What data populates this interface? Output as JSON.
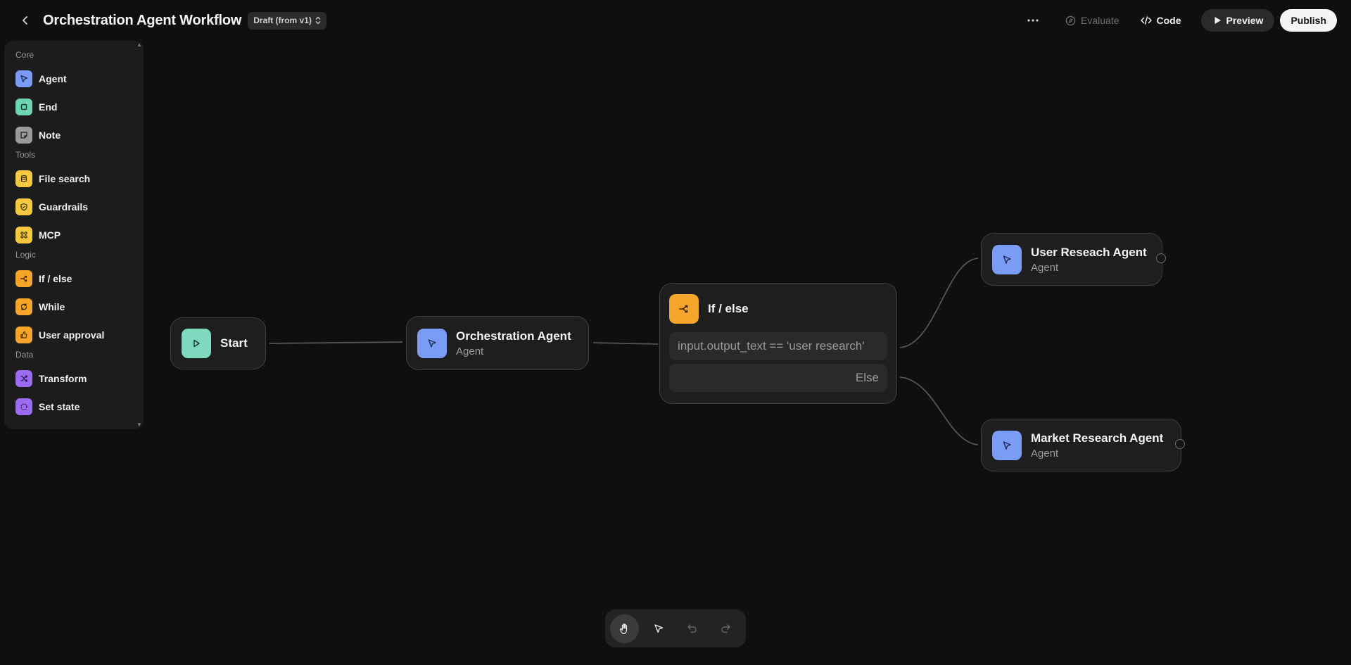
{
  "header": {
    "title": "Orchestration Agent Workflow",
    "draft_badge": "Draft (from v1)",
    "evaluate_label": "Evaluate",
    "code_label": "Code",
    "preview_label": "Preview",
    "publish_label": "Publish"
  },
  "sidebar": {
    "sections": [
      {
        "label": "Core",
        "items": [
          {
            "label": "Agent",
            "icon": "agent-icon",
            "color": "#7b9cf5"
          },
          {
            "label": "End",
            "icon": "end-icon",
            "color": "#6fd4b4"
          },
          {
            "label": "Note",
            "icon": "note-icon",
            "color": "#9a9a9a"
          }
        ]
      },
      {
        "label": "Tools",
        "items": [
          {
            "label": "File search",
            "icon": "database-icon",
            "color": "#f5c842"
          },
          {
            "label": "Guardrails",
            "icon": "shield-icon",
            "color": "#f5c842"
          },
          {
            "label": "MCP",
            "icon": "mcp-icon",
            "color": "#f5c842"
          }
        ]
      },
      {
        "label": "Logic",
        "items": [
          {
            "label": "If / else",
            "icon": "branch-icon",
            "color": "#f5a52a"
          },
          {
            "label": "While",
            "icon": "loop-icon",
            "color": "#f5a52a"
          },
          {
            "label": "User approval",
            "icon": "approval-icon",
            "color": "#f5a52a"
          }
        ]
      },
      {
        "label": "Data",
        "items": [
          {
            "label": "Transform",
            "icon": "shuffle-icon",
            "color": "#9b6cf0"
          },
          {
            "label": "Set state",
            "icon": "state-icon",
            "color": "#9b6cf0"
          }
        ]
      }
    ]
  },
  "nodes": {
    "start": {
      "title": "Start",
      "color": "#7ed9bf"
    },
    "orchestration": {
      "title": "Orchestration Agent",
      "subtitle": "Agent",
      "color": "#7b9cf5"
    },
    "ifelse": {
      "title": "If / else",
      "condition": "input.output_text == 'user research'",
      "else_label": "Else",
      "color": "#f5a52a"
    },
    "user_research": {
      "title": "User Reseach Agent",
      "subtitle": "Agent",
      "color": "#7b9cf5"
    },
    "market_research": {
      "title": "Market Research Agent",
      "subtitle": "Agent",
      "color": "#7b9cf5"
    }
  }
}
